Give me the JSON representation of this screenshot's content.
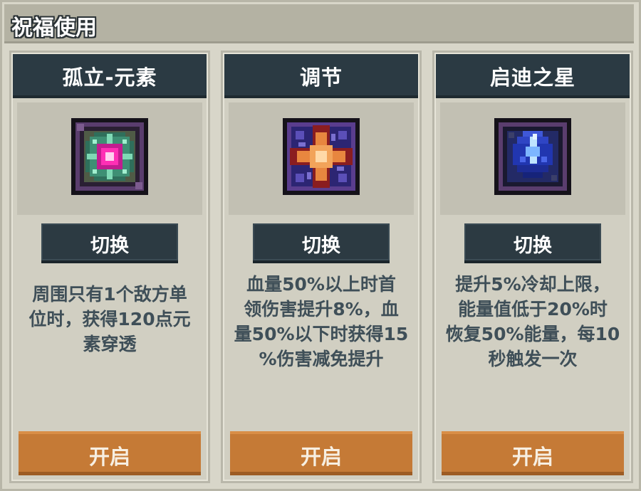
{
  "header": {
    "title": "祝福使用"
  },
  "cards": [
    {
      "title": "孤立-元素",
      "icon": "pink-gem-element-icon",
      "switch_label": "切换",
      "description": [
        "周围只有1个敌方单",
        "位时，获得120点元",
        "素穿透"
      ],
      "open_label": "开启"
    },
    {
      "title": "调节",
      "icon": "orange-star-cross-icon",
      "switch_label": "切换",
      "description": [
        "血量50%以上时首",
        "领伤害提升8%，血",
        "量50%以下时获得15",
        "%伤害减免提升"
      ],
      "open_label": "开启"
    },
    {
      "title": "启迪之星",
      "icon": "blue-crystal-icon",
      "switch_label": "切换",
      "description": [
        "提升5%冷却上限，",
        "能量值低于20%时",
        "恢复50%能量，每10",
        "秒触发一次"
      ],
      "open_label": "开启"
    }
  ]
}
